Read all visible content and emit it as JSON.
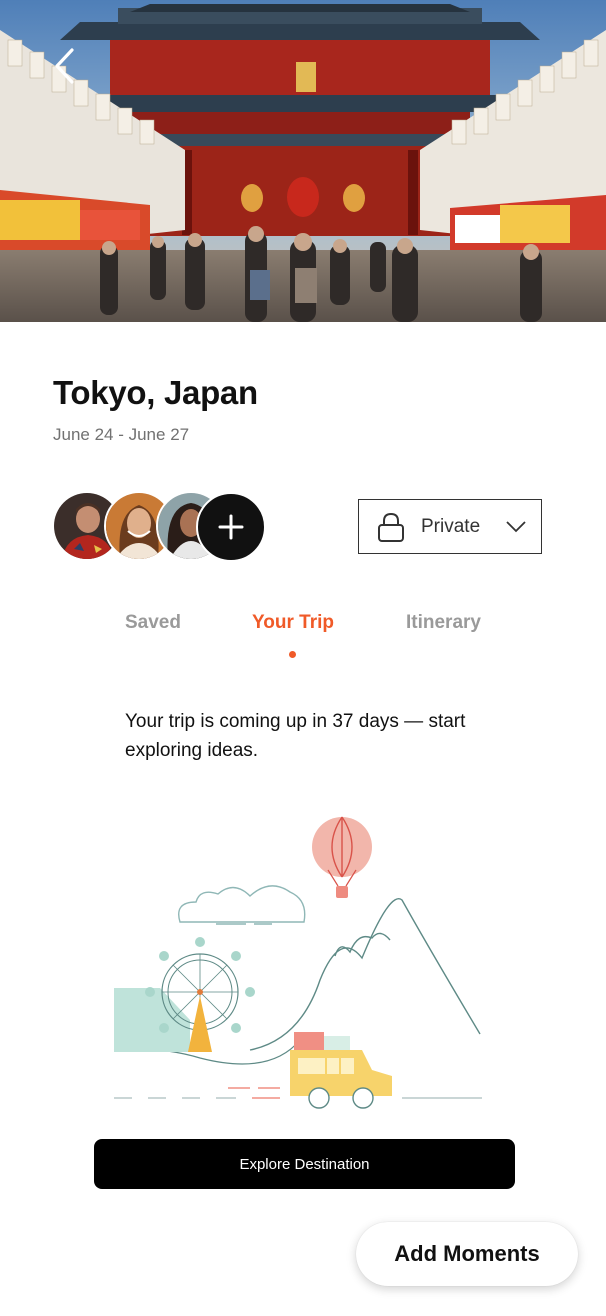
{
  "header": {
    "back_icon": "chevron-left-icon",
    "hero_image": "Senso-ji Kaminarimon gate with market street"
  },
  "destination": {
    "title": "Tokyo, Japan",
    "dates": "June 24 - June 27"
  },
  "collaborators": {
    "add_icon": "plus-icon"
  },
  "privacy": {
    "label": "Private",
    "icon": "lock-icon",
    "chevron": "chevron-down-icon"
  },
  "tabs": [
    {
      "label": "Saved",
      "active": false
    },
    {
      "label": "Your Trip",
      "active": true
    },
    {
      "label": "Itinerary",
      "active": false
    }
  ],
  "message": "Your trip is coming up in 37 days — start exploring ideas.",
  "actions": {
    "explore_label": "Explore Destination",
    "moments_label": "Add Moments"
  },
  "colors": {
    "accent": "#f05a28",
    "muted_tab": "#9a9a9a",
    "primary_button": "#000000"
  }
}
